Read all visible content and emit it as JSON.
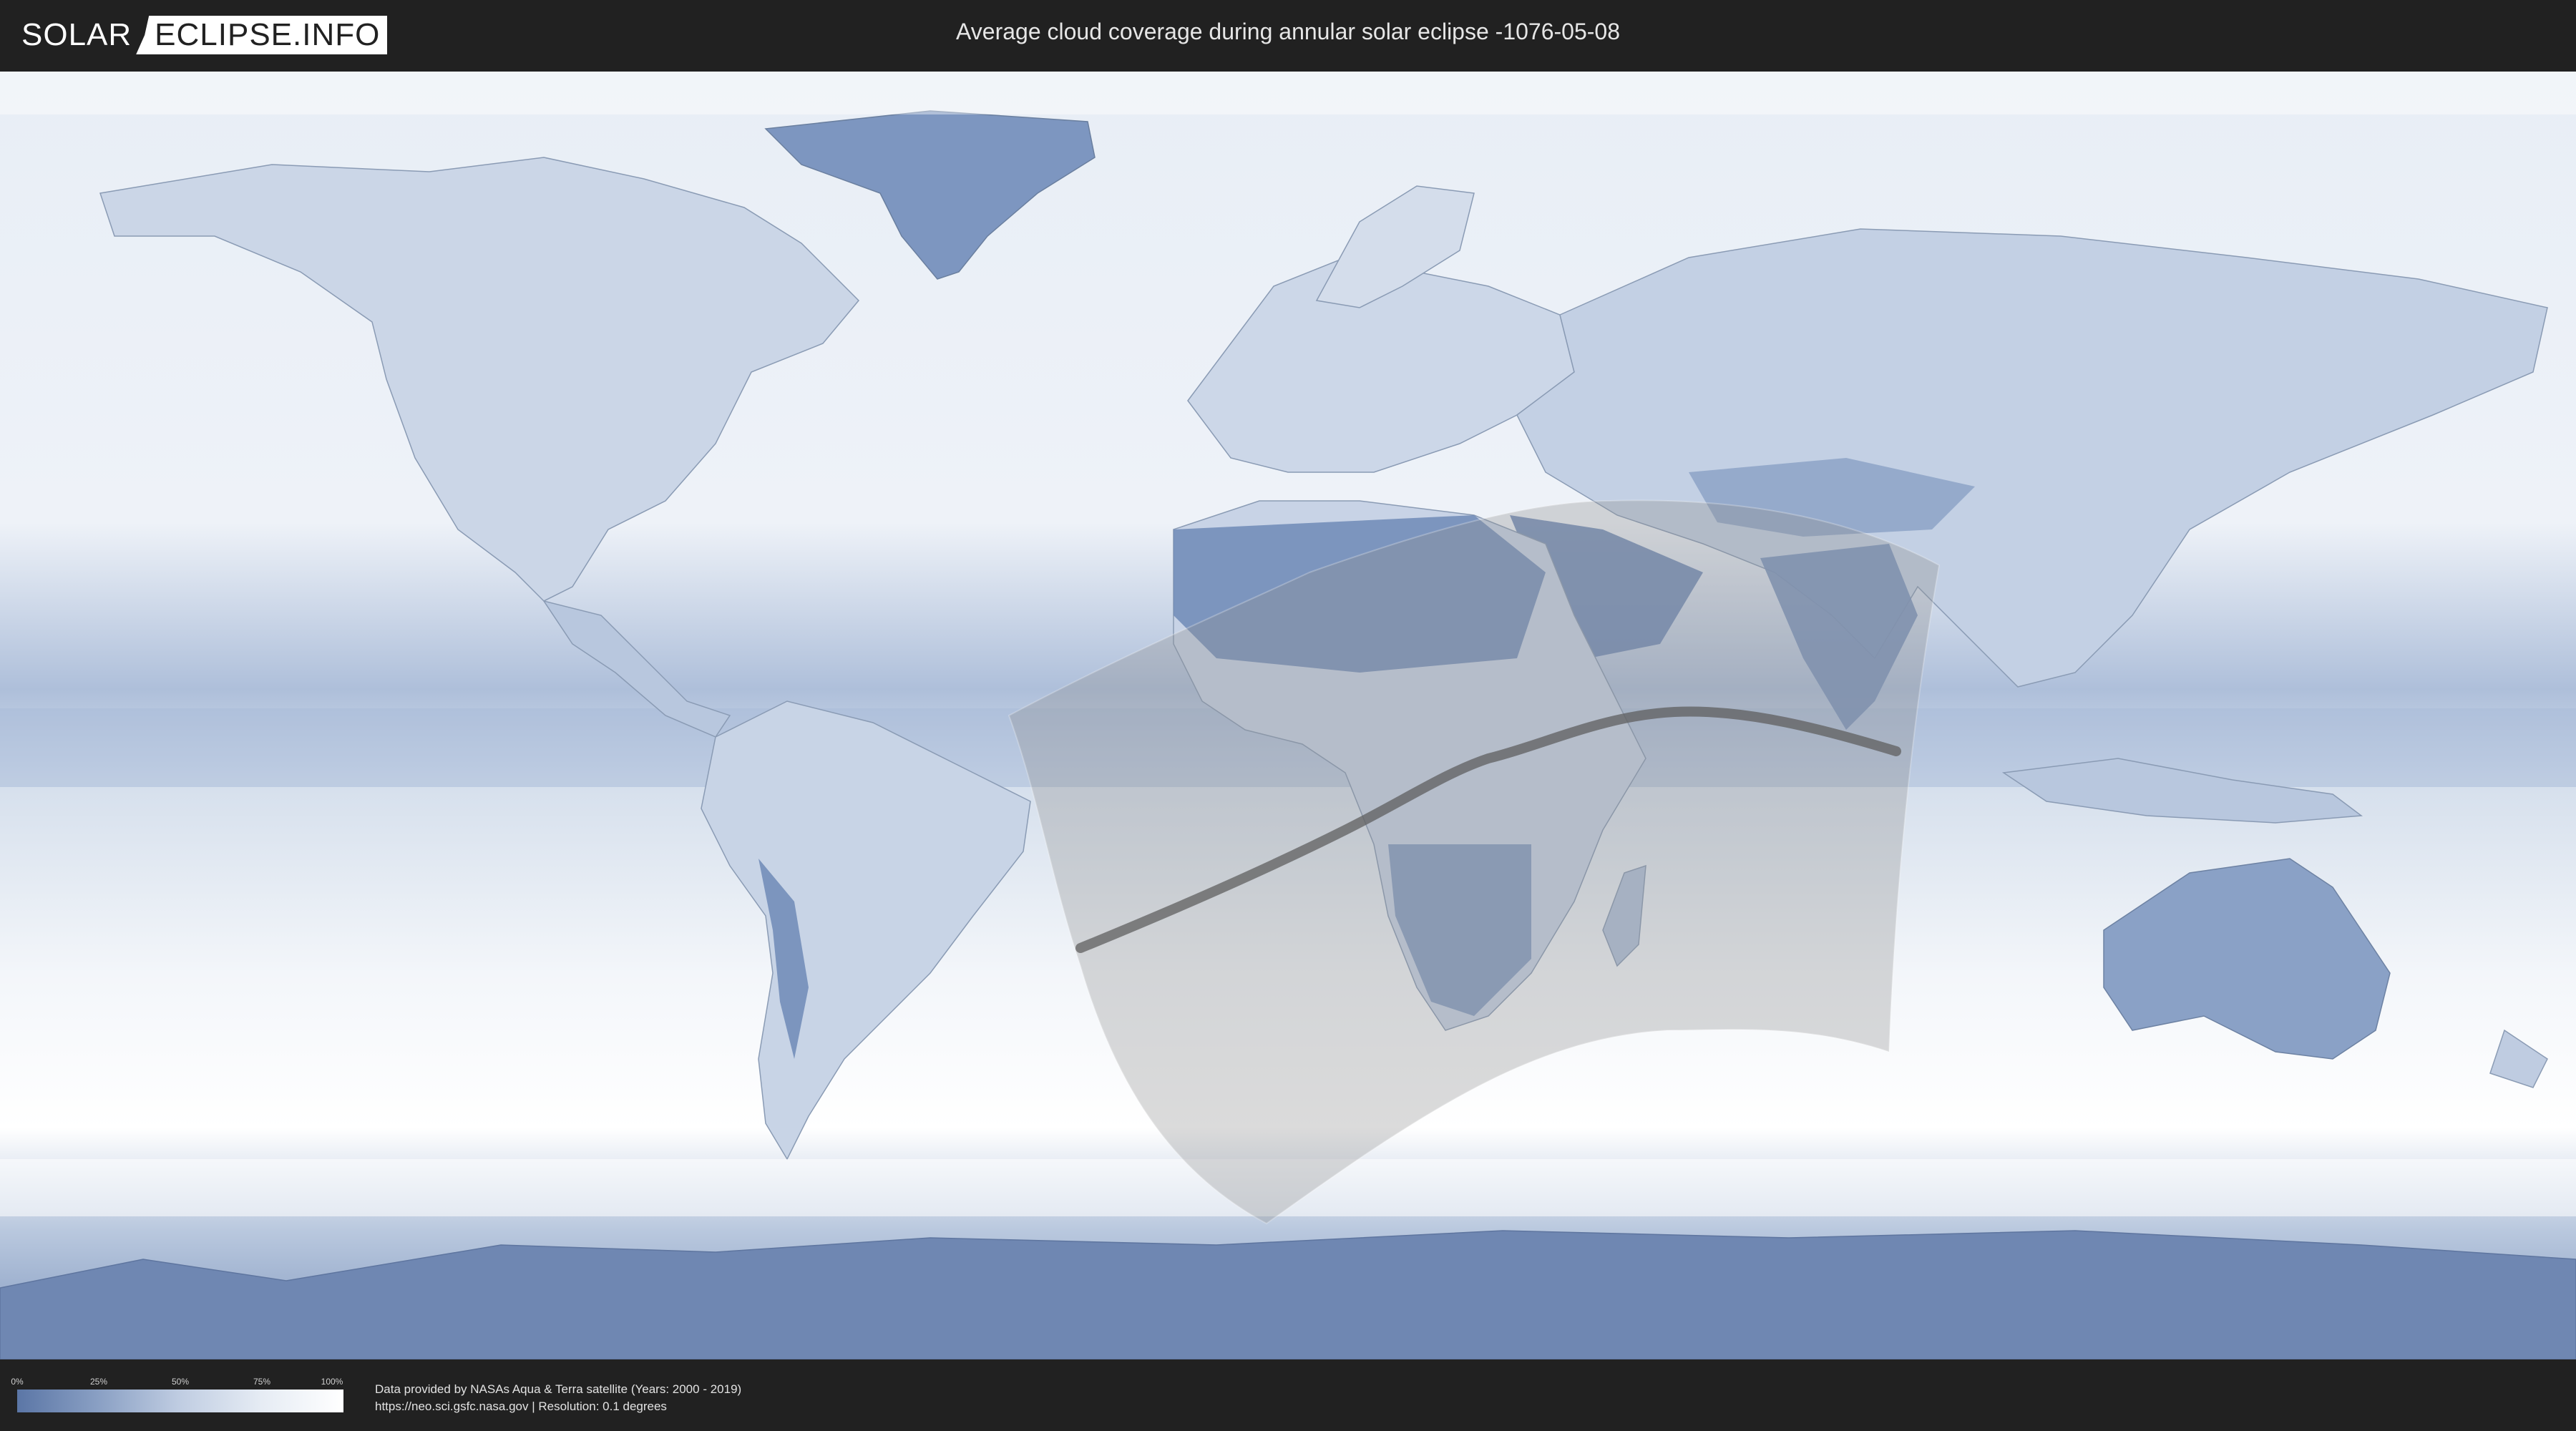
{
  "header": {
    "logo_left": "SOLAR",
    "logo_right": "ECLIPSE.INFO",
    "title": "Average cloud coverage during annular solar eclipse -1076-05-08"
  },
  "map": {
    "ocean_color": "#dfe7f1",
    "land_color": "#cdd8e8",
    "cloud_dense_color": "#ffffff",
    "cloud_sparse_color": "#5b76a6",
    "shadow_color": "#9a9a9a",
    "path_color": "#5f5f5f",
    "icons": [
      "world-map",
      "eclipse-shadow-region",
      "central-line"
    ]
  },
  "legend": {
    "ticks": [
      "0%",
      "25%",
      "50%",
      "75%",
      "100%"
    ],
    "gradient_start": "#5b76a6",
    "gradient_end": "#ffffff"
  },
  "footer": {
    "line1": "Data provided by NASAs Aqua & Terra satellite (Years: 2000 - 2019)",
    "line2": "https://neo.sci.gsfc.nasa.gov | Resolution: 0.1 degrees"
  }
}
